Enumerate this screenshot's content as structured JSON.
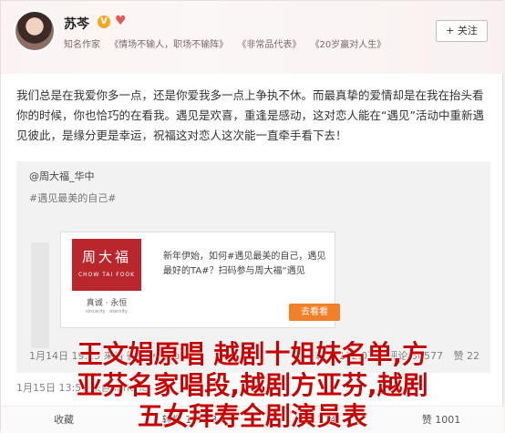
{
  "user": {
    "name": "苏芩",
    "badge": "V",
    "tags": [
      "知名作家",
      "《情场不输人，职场不输阵》",
      "《非常品代表》",
      "《20岁赢对人生》"
    ],
    "follow_label": "+ 关注"
  },
  "post": {
    "text": "我们总是在我爱你多一点，还是你爱我多一点上争执不休。而最真挚的爱情却是在我在抬头看你的时候，你也恰巧的在看我。遇见是欢喜，重逢是感动，这对恋人能在“遇见”活动中重新遇见彼此，是缘分更是幸运，祝福这对恋人这次能一直牵手看下去！",
    "time": "1月15日 13:57 来自 iPhone"
  },
  "quote": {
    "author": "@周大福_华中",
    "snippet": "#遇见最美的自己#",
    "ad": {
      "logo_cn": "周大福",
      "logo_en": "CHOW TAI FOOK",
      "logo_sub": "真诚 · 永恒",
      "logo_sub2": "sincerity · eternity",
      "text": "新年伊始，如何#遇见最美的自己，遇见最好的TA#？扫码参与周大福“遇见",
      "button": "去看看"
    },
    "time": "1月14日 19:25 来自 微博 weibo.com",
    "stats": [
      "转发 102.0万",
      "评论 30577",
      "赞 22"
    ]
  },
  "actions": [
    "收藏",
    "转发 10133",
    "评论 774",
    "赞 1001"
  ],
  "overlay": {
    "line1": "王文娟原唱 越剧十姐妹名单,方",
    "line2": "亚芬名家唱段,越剧方亚芬,越剧",
    "line3": "五女拜寿全剧演员表"
  }
}
